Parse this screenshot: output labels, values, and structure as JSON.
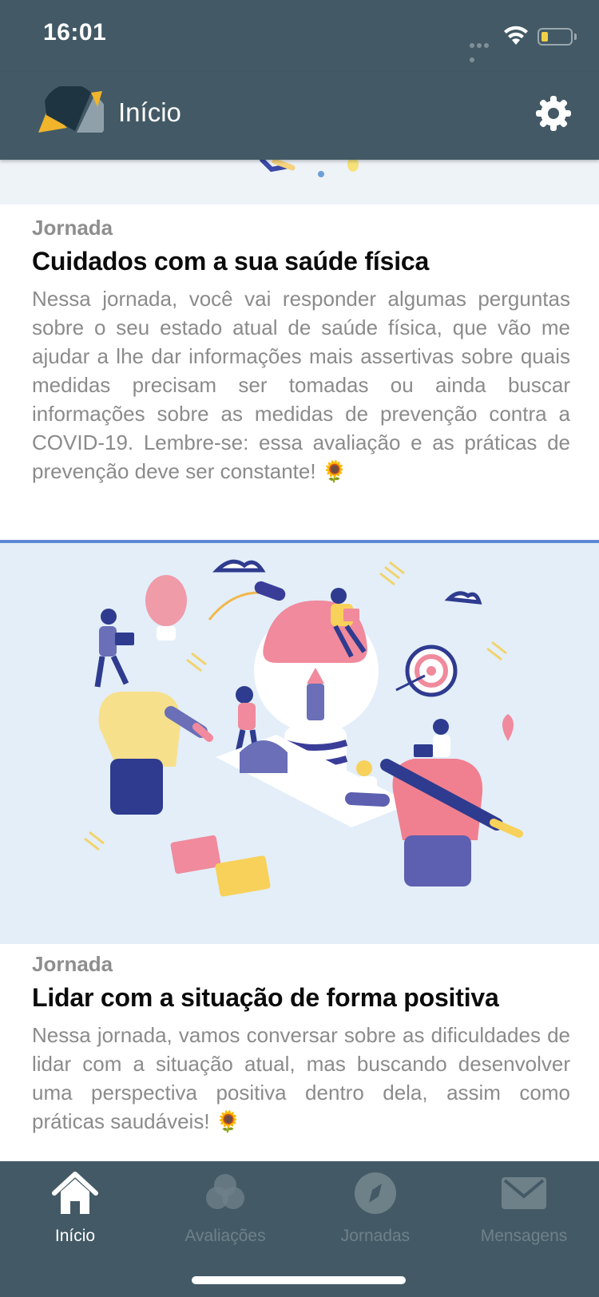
{
  "status": {
    "time": "16:01"
  },
  "header": {
    "title": "Início"
  },
  "cards": [
    {
      "kicker": "Jornada",
      "title": "Cuidados com a sua saúde física",
      "description": "Nessa jornada, você vai responder algumas perguntas sobre o seu estado atual de saúde física, que vão me ajudar a lhe dar informações mais assertivas sobre quais medidas precisam ser tomadas ou ainda buscar informações sobre as medidas de prevenção contra a COVID-19. Lembre-se: essa avaliação e as práticas de prevenção deve ser constante! 🌻"
    },
    {
      "kicker": "Jornada",
      "title": "Lidar com a situação de forma positiva",
      "description": "Nessa jornada, vamos conversar sobre as dificuldades de lidar com a situação atual, mas buscando desenvolver uma perspectiva positiva dentro dela, assim como práticas saudáveis! 🌻"
    }
  ],
  "tabs": [
    {
      "label": "Início",
      "icon": "home-icon",
      "active": true
    },
    {
      "label": "Avaliações",
      "icon": "evaluations-icon",
      "active": false
    },
    {
      "label": "Jornadas",
      "icon": "compass-icon",
      "active": false
    },
    {
      "label": "Mensagens",
      "icon": "mail-icon",
      "active": false
    }
  ],
  "colors": {
    "bar": "#435a66",
    "accent": "#5c89d6",
    "illustration_bg": "#e3eef9",
    "tab_inactive": "#6e8088",
    "tab_active": "#ffffff"
  }
}
